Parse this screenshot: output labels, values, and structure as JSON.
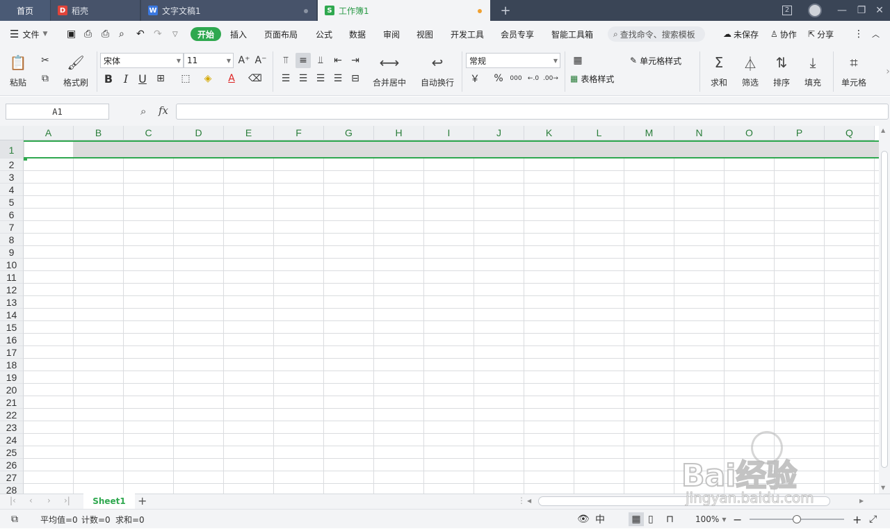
{
  "titlebar": {
    "tabs": [
      {
        "label": "首页"
      },
      {
        "label": "稻壳",
        "icon": "docer-icon"
      },
      {
        "label": "文字文稿1",
        "icon": "writer-icon"
      },
      {
        "label": "工作簿1",
        "icon": "spreadsheet-icon"
      }
    ],
    "new_tab": "+",
    "window_count": "2"
  },
  "menubar": {
    "file": "文件",
    "tabs": [
      "开始",
      "插入",
      "页面布局",
      "公式",
      "数据",
      "审阅",
      "视图",
      "开发工具",
      "会员专享",
      "智能工具箱"
    ],
    "search_placeholder": "查找命令、搜索模板",
    "unsaved": "未保存",
    "collab": "协作",
    "share": "分享"
  },
  "ribbon": {
    "paste": "粘贴",
    "format_painter": "格式刷",
    "font_name": "宋体",
    "font_size": "11",
    "merge_center": "合并居中",
    "wrap_text": "自动换行",
    "number_format": "常规",
    "cell_style": "单元格样式",
    "table_style": "表格样式",
    "sum": "求和",
    "filter": "筛选",
    "sort": "排序",
    "fill": "填充",
    "cell": "单元格",
    "bold": "B",
    "italic": "I",
    "underline": "U",
    "currency": "￥",
    "percent": "%",
    "thousands": "000"
  },
  "formulabar": {
    "cell_ref": "A1",
    "fx": "fx"
  },
  "grid": {
    "columns": [
      "A",
      "B",
      "C",
      "D",
      "E",
      "F",
      "G",
      "H",
      "I",
      "J",
      "K",
      "L",
      "M",
      "N",
      "O",
      "P",
      "Q"
    ],
    "rows": [
      "1",
      "2",
      "3",
      "4",
      "5",
      "6",
      "7",
      "8",
      "9",
      "10",
      "11",
      "12",
      "13",
      "14",
      "15",
      "16",
      "17",
      "18",
      "19",
      "20",
      "21",
      "22",
      "23",
      "24",
      "25",
      "26",
      "27",
      "28"
    ],
    "selected_cell": "A1"
  },
  "sheets": {
    "tabs": [
      "Sheet1"
    ],
    "add": "+"
  },
  "status": {
    "average": "平均值=0",
    "count": "计数=0",
    "sum": "求和=0",
    "zoom": "100%"
  },
  "watermark": {
    "text": "Bai经验",
    "url": "jingyan.baidu.com"
  },
  "colors": {
    "accent": "#2fa84f",
    "titlebar": "#3a4556",
    "header_text": "#2a7d3a"
  }
}
